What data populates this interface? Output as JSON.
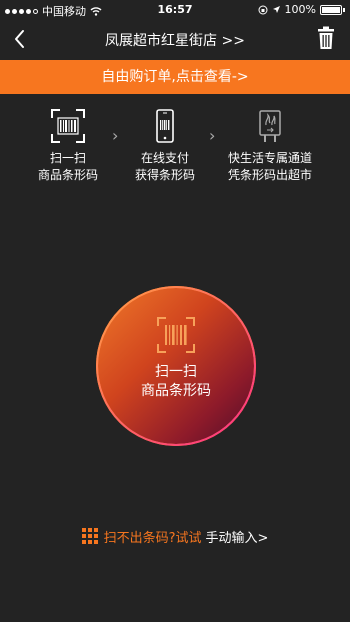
{
  "status_bar": {
    "carrier": "中国移动",
    "time": "16:57",
    "battery": "100%"
  },
  "nav": {
    "store_name": "凤展超市红星街店 >>",
    "icons": {
      "back": "chevron-left-icon",
      "trash": "trash-icon"
    }
  },
  "banner": {
    "text": "自由购订单,点击查看->",
    "color": "#f7761f"
  },
  "steps": [
    {
      "line1": "扫一扫",
      "line2": "商品条形码",
      "icon": "barcode-scan-icon"
    },
    {
      "line1": "在线支付",
      "line2": "获得条形码",
      "icon": "phone-barcode-icon"
    },
    {
      "line1": "快生活专属通道",
      "line2": "凭条形码出超市",
      "icon": "exit-gate-icon"
    }
  ],
  "scan_button": {
    "line1": "扫一扫",
    "line2": "商品条形码",
    "icon": "barcode-scan-icon"
  },
  "manual_entry": {
    "prefix": "扫不出条码?试试",
    "link": "手动输入>",
    "icon": "keypad-icon"
  },
  "colors": {
    "background": "#232323",
    "accent": "#f7761f"
  }
}
